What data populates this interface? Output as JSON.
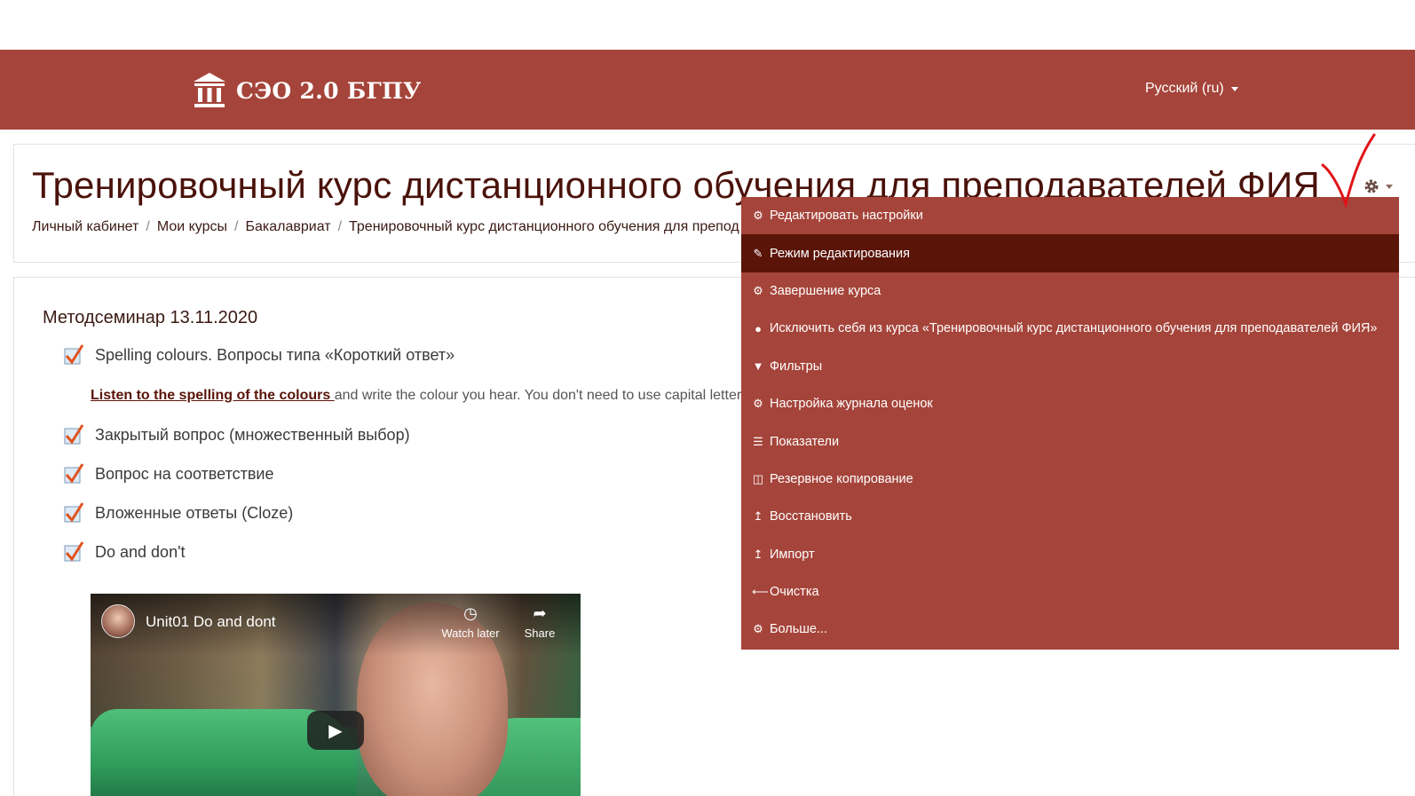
{
  "header": {
    "site_name": "СЭО 2.0 БГПУ",
    "language": "Русский (ru)"
  },
  "course": {
    "title": "Тренировочный курс дистанционного обучения для преподавателей ФИЯ",
    "breadcrumb": [
      "Личный кабинет",
      "Мои курсы",
      "Бакалавриат",
      "Тренировочный курс дистанционного обучения для препод"
    ]
  },
  "section": {
    "title": "Методсеминар 13.11.2020",
    "activities": [
      "Spelling colours. Вопросы типа «Короткий ответ»",
      "Закрытый вопрос (множественный выбор)",
      "Вопрос на соответствие",
      "Вложенные ответы (Cloze)",
      "Do and don't"
    ],
    "description_link": "Listen to the spelling of the colours ",
    "description_text": "and write the colour you hear. You don't need to use capital letter"
  },
  "video": {
    "title": "Unit01 Do and dont",
    "watch_later": "Watch later",
    "share": "Share"
  },
  "menu": {
    "items": [
      {
        "label": "Редактировать настройки",
        "icon": "gear-icon"
      },
      {
        "label": "Режим редактирования",
        "icon": "pencil-icon"
      },
      {
        "label": "Завершение курса",
        "icon": "gear-icon"
      },
      {
        "label": "Исключить себя из курса «Тренировочный курс дистанционного обучения для преподавателей ФИЯ»",
        "icon": "user-icon"
      },
      {
        "label": "Фильтры",
        "icon": "filter-icon"
      },
      {
        "label": "Настройка журнала оценок",
        "icon": "gear-icon"
      },
      {
        "label": "Показатели",
        "icon": "table-icon"
      },
      {
        "label": "Резервное копирование",
        "icon": "file-archive-icon"
      },
      {
        "label": "Восстановить",
        "icon": "upload-icon"
      },
      {
        "label": "Импорт",
        "icon": "upload-icon"
      },
      {
        "label": "Очистка",
        "icon": "arrow-left-icon"
      },
      {
        "label": "Больше...",
        "icon": "gear-icon"
      }
    ]
  },
  "colors": {
    "brand": "#a5443a",
    "menu_active": "#5a1408",
    "title_text": "#4a120a"
  }
}
